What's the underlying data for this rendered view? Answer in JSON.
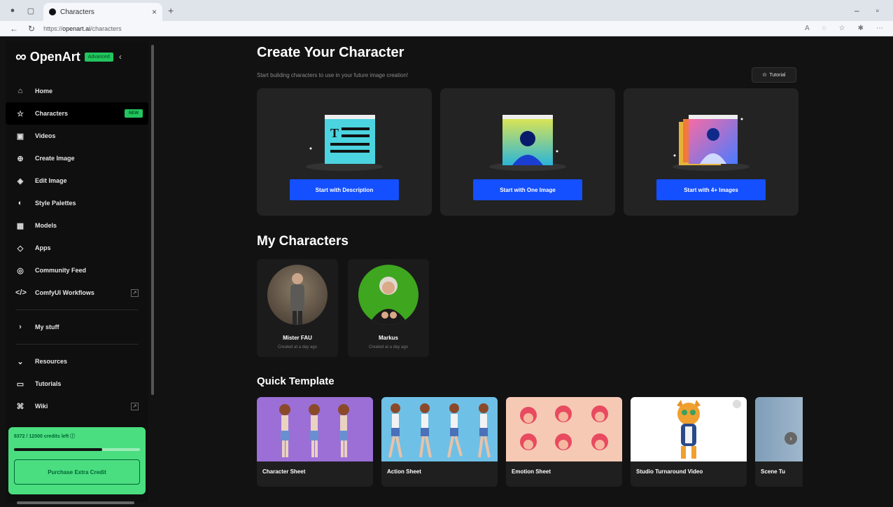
{
  "browser": {
    "tab_title": "Characters",
    "url_prefix": "https://",
    "url_host": "openart.ai",
    "url_path": "/characters"
  },
  "sidebar": {
    "brand": "OpenArt",
    "plan_badge": "Advanced",
    "items": [
      {
        "label": "Home",
        "icon": "home-icon"
      },
      {
        "label": "Characters",
        "icon": "star-icon",
        "tag": "NEW"
      },
      {
        "label": "Videos",
        "icon": "video-icon"
      },
      {
        "label": "Create Image",
        "icon": "plus-circle-icon"
      },
      {
        "label": "Edit Image",
        "icon": "edit-icon"
      },
      {
        "label": "Style Palettes",
        "icon": "palette-icon"
      },
      {
        "label": "Models",
        "icon": "grid-icon"
      },
      {
        "label": "Apps",
        "icon": "apps-icon"
      },
      {
        "label": "Community Feed",
        "icon": "compass-icon"
      },
      {
        "label": "ComfyUI Workflows",
        "icon": "code-icon"
      }
    ],
    "my_stuff": "My stuff",
    "resources": "Resources",
    "resource_items": [
      {
        "label": "Tutorials",
        "icon": "book-icon"
      },
      {
        "label": "Wiki",
        "icon": "cap-icon"
      }
    ],
    "credits_text": "8372 / 12000 credits left ⓘ",
    "credits_fraction": 0.7,
    "purchase_label": "Purchase Extra Credit"
  },
  "main": {
    "title": "Create Your Character",
    "subtitle": "Start building characters to use in your future image creation!",
    "tutorial_label": "Tutorial",
    "start_cards": [
      {
        "button": "Start with Description"
      },
      {
        "button": "Start with One Image"
      },
      {
        "button": "Start with 4+ Images"
      }
    ],
    "my_characters_title": "My Characters",
    "characters": [
      {
        "name": "Mister FAU",
        "created": "Created at a day ago"
      },
      {
        "name": "Markus",
        "created": "Created at a day ago"
      }
    ],
    "quick_template_title": "Quick Template",
    "templates": [
      {
        "label": "Character Sheet",
        "bg": "#9b6fd6"
      },
      {
        "label": "Action Sheet",
        "bg": "#6fc0e6"
      },
      {
        "label": "Emotion Sheet",
        "bg": "#f6c9b4"
      },
      {
        "label": "Studio Turnaround Video",
        "bg": "#ffffff"
      },
      {
        "label": "Scene Tu",
        "bg": "#9fb7c9"
      }
    ]
  },
  "colors": {
    "accent": "#22c55e",
    "primary_button": "#1450ff"
  }
}
